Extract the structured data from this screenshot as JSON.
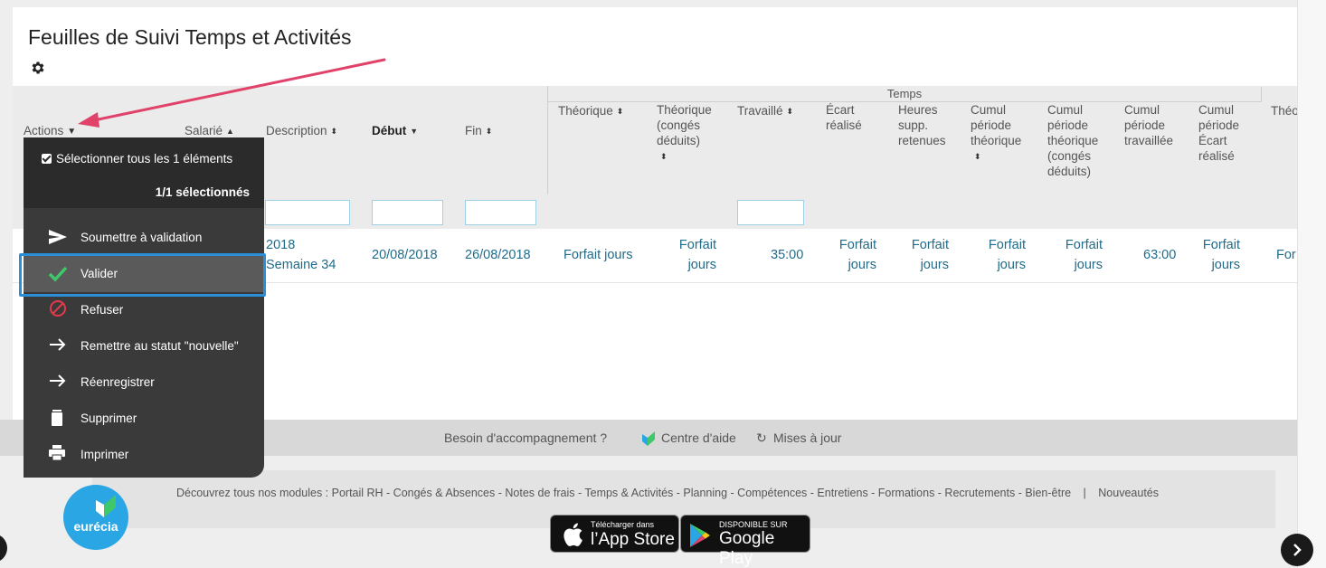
{
  "page": {
    "title": "Feuilles de Suivi Temps et Activités",
    "settings_icon": "gear-icon"
  },
  "table": {
    "group_header": "Temps",
    "columns": {
      "actions": "Actions",
      "salarie": "Salarié",
      "description": "Description",
      "debut": "Début",
      "fin": "Fin",
      "theorique": "Théorique",
      "theorique_conges": [
        "Théorique",
        "(congés",
        "déduits)"
      ],
      "travaille": "Travaillé",
      "ecart_realise": [
        "Écart",
        "réalisé"
      ],
      "heures_supp": [
        "Heures",
        "supp.",
        "retenues"
      ],
      "cumul_theorique": [
        "Cumul",
        "période",
        "théorique"
      ],
      "cumul_theorique_conges": [
        "Cumul",
        "période",
        "théorique",
        "(congés",
        "déduits)"
      ],
      "cumul_travaillee": [
        "Cumul",
        "période",
        "travaillée"
      ],
      "cumul_ecart": [
        "Cumul",
        "période",
        "Écart",
        "réalisé"
      ],
      "theo_cut": "Théo"
    },
    "row": {
      "description": [
        "2018",
        "Semaine 34"
      ],
      "debut": "20/08/2018",
      "fin": "26/08/2018",
      "theorique": "Forfait jours",
      "theorique_conges": [
        "Forfait",
        "jours"
      ],
      "travaille": "35:00",
      "ecart_realise": [
        "Forfait",
        "jours"
      ],
      "heures_supp": [
        "Forfait",
        "jours"
      ],
      "cumul_theorique": [
        "Forfait",
        "jours"
      ],
      "cumul_theorique_conges": [
        "Forfait",
        "jours"
      ],
      "cumul_travaillee": "63:00",
      "cumul_ecart": [
        "Forfait",
        "jours"
      ],
      "cut": "For"
    }
  },
  "actions_menu": {
    "select_all": "Sélectionner tous les 1 éléments",
    "selected_count": "1/1 sélectionnés",
    "items": [
      {
        "label": "Soumettre à validation",
        "icon": "send-icon"
      },
      {
        "label": "Valider",
        "icon": "check-icon"
      },
      {
        "label": "Refuser",
        "icon": "forbidden-icon"
      },
      {
        "label": "Remettre au statut \"nouvelle\"",
        "icon": "arrow-right-icon"
      },
      {
        "label": "Réenregistrer",
        "icon": "arrow-right-icon"
      },
      {
        "label": "Supprimer",
        "icon": "trash-icon"
      },
      {
        "label": "Imprimer",
        "icon": "print-icon"
      }
    ],
    "highlighted": "Valider"
  },
  "footer": {
    "help_question": "Besoin d'accompagnement ?",
    "help_center": "Centre d'aide",
    "updates": "Mises à jour",
    "modules_text": "Découvrez tous nos modules : Portail RH - Congés & Absences - Notes de frais - Temps & Activités - Planning - Compétences - Entretiens - Formations - Recrutements - Bien-être",
    "separator": "|",
    "news": "Nouveautés",
    "app_store_small": "Télécharger dans",
    "app_store_big": "l’App Store",
    "google_small": "DISPONIBLE SUR",
    "google_big": "Google Play",
    "logo_text": "eurécia"
  },
  "colors": {
    "accent_link": "#1f6b8a",
    "menu_bg": "#3a3a3a",
    "highlight_border": "#2b8fd8",
    "check_green": "#3fc86a",
    "annotation_arrow": "#e0426a",
    "logo_blue": "#2aa6e4"
  }
}
